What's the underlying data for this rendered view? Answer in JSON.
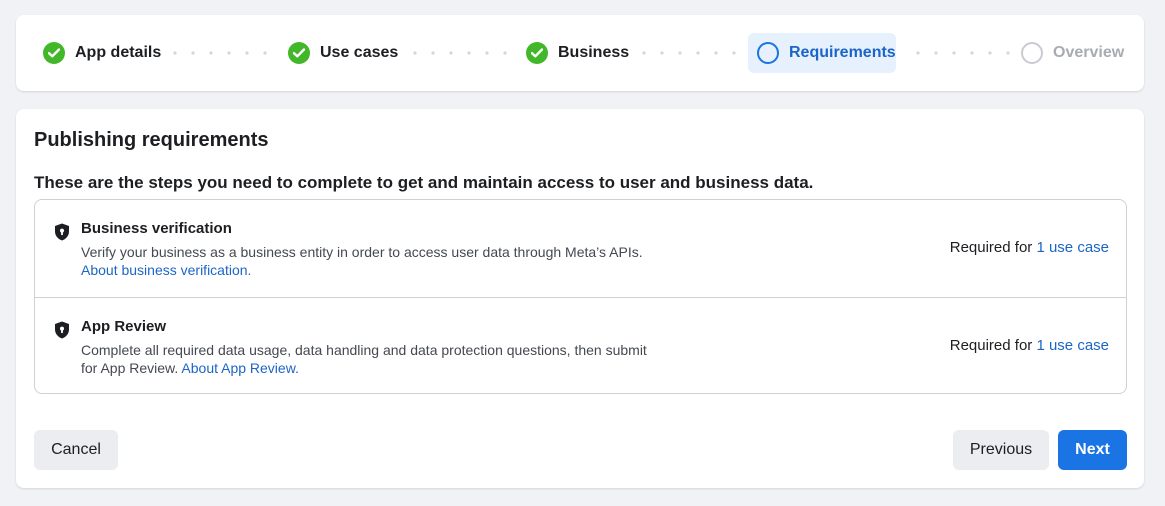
{
  "stepper": {
    "steps": [
      {
        "label": "App details",
        "state": "done",
        "icon": "check-circle-icon"
      },
      {
        "label": "Use cases",
        "state": "done",
        "icon": "check-circle-icon"
      },
      {
        "label": "Business",
        "state": "done",
        "icon": "check-circle-icon"
      },
      {
        "label": "Requirements",
        "state": "current",
        "icon": "ring-icon"
      },
      {
        "label": "Overview",
        "state": "future",
        "icon": "ring-icon"
      }
    ]
  },
  "main": {
    "title": "Publishing requirements",
    "subtitle": "These are the steps you need to complete to get and maintain access to user and business data.",
    "requirements": [
      {
        "icon": "shield-lock-icon",
        "title": "Business verification",
        "description": "Verify your business as a business entity in order to access user data through Meta’s APIs.",
        "link": "About business verification.",
        "status_prefix": "Required for",
        "status_link": "1 use case"
      },
      {
        "icon": "shield-lock-icon",
        "title": "App Review",
        "description": "Complete all required data usage, data handling and data protection questions, then submit for App Review.",
        "link": "About App Review.",
        "status_prefix": "Required for",
        "status_link": "1 use case"
      }
    ]
  },
  "footer": {
    "cancel_label": "Cancel",
    "previous_label": "Previous",
    "next_label": "Next"
  },
  "colors": {
    "accent": "#1b74e4",
    "success": "#42b72a",
    "link": "#1b65c7",
    "background": "#f0f2f5"
  }
}
